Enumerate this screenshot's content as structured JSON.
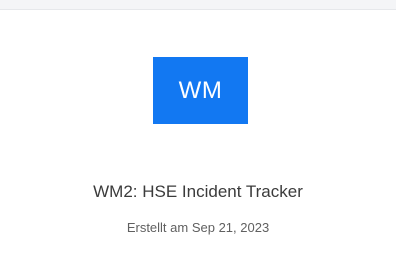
{
  "app": {
    "avatar_initials": "WM",
    "avatar_color": "#1278f2",
    "title": "WM2: HSE Incident Tracker",
    "subtitle": "Erstellt am Sep 21, 2023"
  }
}
